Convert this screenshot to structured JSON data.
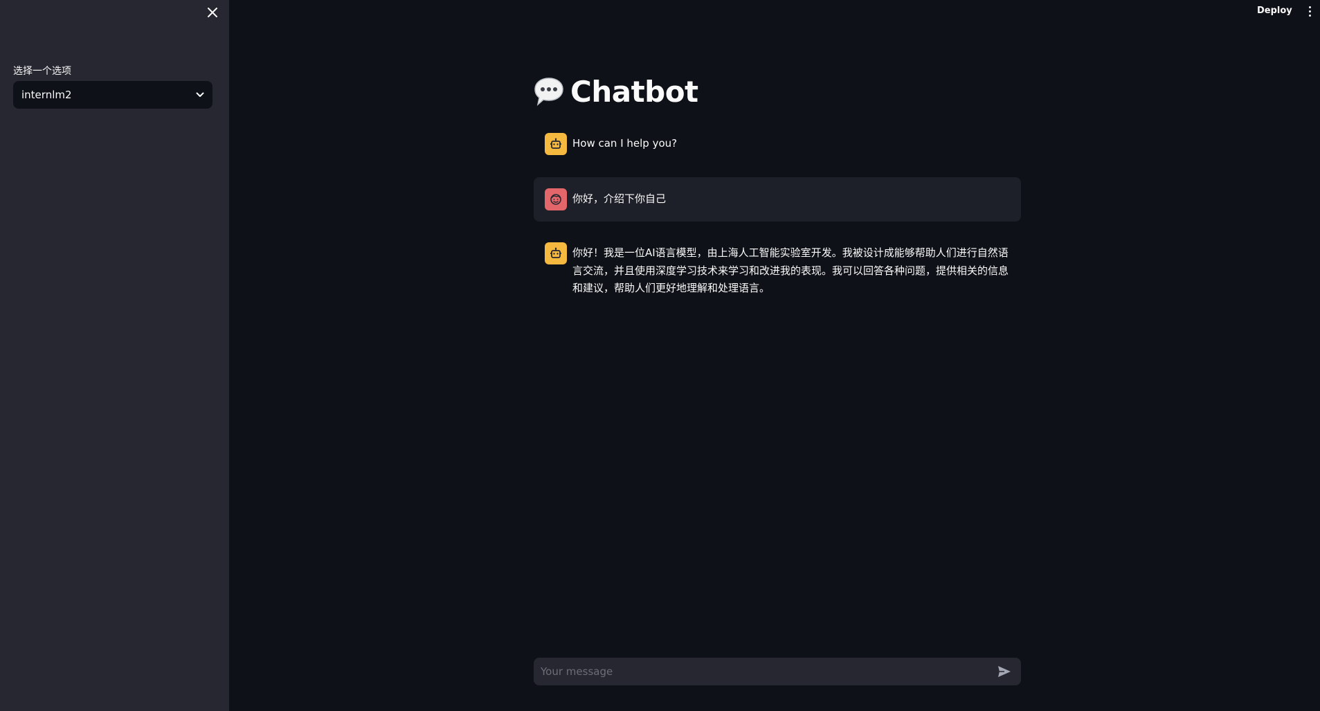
{
  "sidebar": {
    "select_label": "选择一个选项",
    "selected_model": "internlm2"
  },
  "header": {
    "deploy_label": "Deploy"
  },
  "main": {
    "title": "Chatbot",
    "title_icon": "speech-bubble-icon",
    "messages": [
      {
        "role": "assistant",
        "avatar_icon": "robot-icon",
        "text": "How can I help you?"
      },
      {
        "role": "user",
        "avatar_icon": "smiley-face-icon",
        "text": "你好，介绍下你自己"
      },
      {
        "role": "assistant",
        "avatar_icon": "robot-icon",
        "text": "你好！我是一位AI语言模型，由上海人工智能实验室开发。我被设计成能够帮助人们进行自然语言交流，并且使用深度学习技术来学习和改进我的表现。我可以回答各种问题，提供相关的信息和建议，帮助人们更好地理解和处理语言。"
      }
    ]
  },
  "chat_input": {
    "placeholder": "Your message"
  },
  "colors": {
    "background": "#0e1117",
    "sidebar": "#262730",
    "bot_avatar": "#f5b940",
    "user_avatar": "#e2666a"
  }
}
